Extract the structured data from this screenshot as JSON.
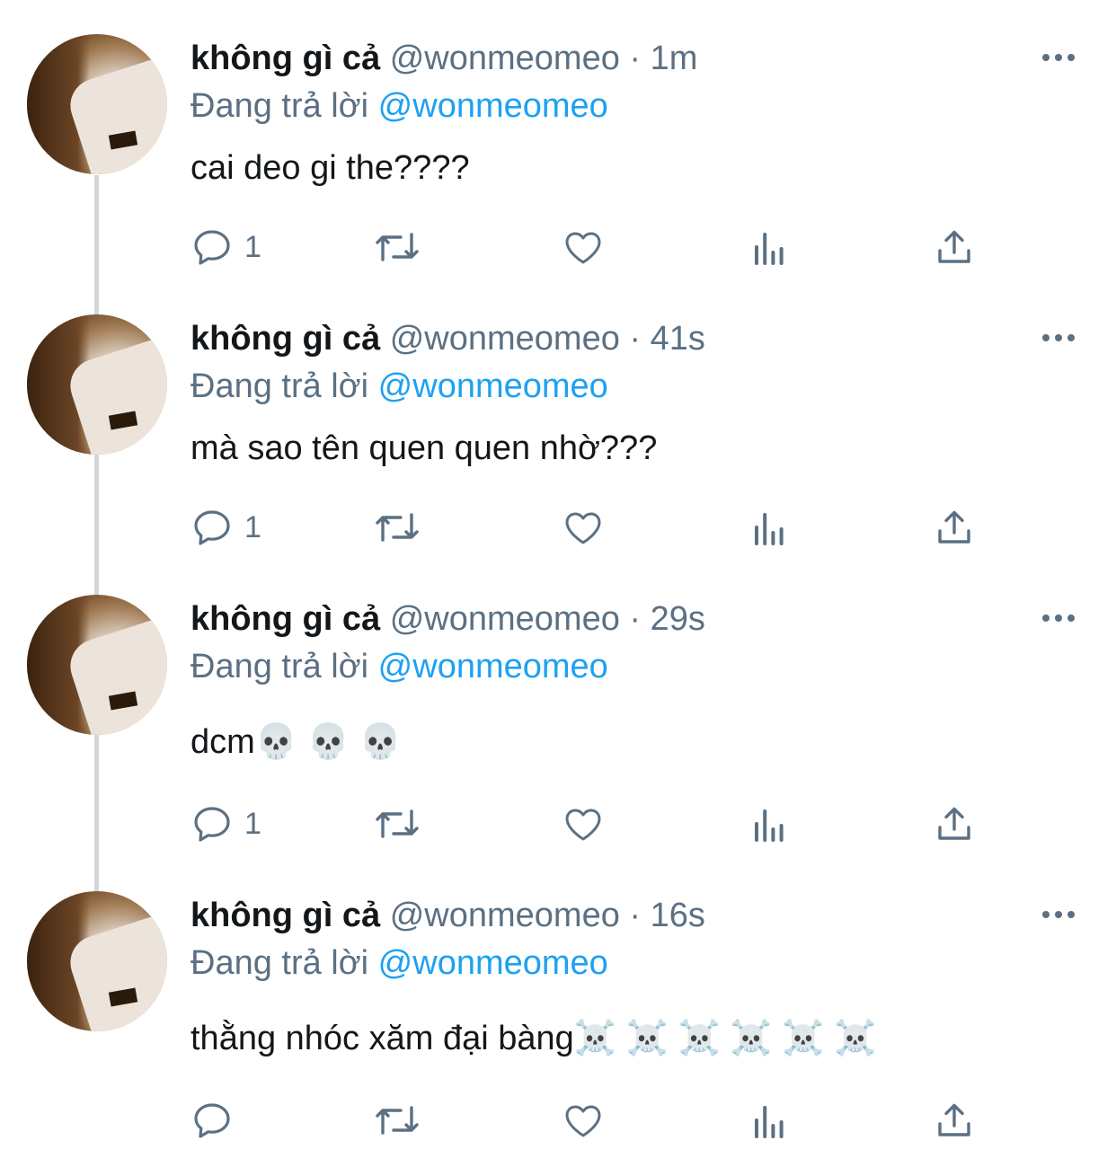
{
  "tweets": [
    {
      "name": "không gì cả",
      "handle": "@wonmeomeo",
      "time": "1m",
      "replying_label": "Đang trả lời",
      "replying_to": "@wonmeomeo",
      "text": "cai deo gi the????",
      "reply_count": "1"
    },
    {
      "name": "không gì cả",
      "handle": "@wonmeomeo",
      "time": "41s",
      "replying_label": "Đang trả lời",
      "replying_to": "@wonmeomeo",
      "text": "mà sao tên quen quen nhờ???",
      "reply_count": "1"
    },
    {
      "name": "không gì cả",
      "handle": "@wonmeomeo",
      "time": "29s",
      "replying_label": "Đang trả lời",
      "replying_to": "@wonmeomeo",
      "text": "dcm💀 💀 💀",
      "reply_count": "1"
    },
    {
      "name": "không gì cả",
      "handle": "@wonmeomeo",
      "time": "16s",
      "replying_label": "Đang trả lời",
      "replying_to": "@wonmeomeo",
      "text": "thằng nhóc xăm đại bàng☠️ ☠️ ☠️ ☠️ ☠️ ☠️",
      "reply_count": ""
    }
  ],
  "separator": " · ",
  "icons": [
    "reply-icon",
    "retweet-icon",
    "like-icon",
    "analytics-icon",
    "share-icon",
    "more-icon"
  ],
  "colors": {
    "text": "#14171a",
    "secondary": "#5b7083",
    "link": "#1da1f2",
    "thread_line": "#d2d7db"
  }
}
